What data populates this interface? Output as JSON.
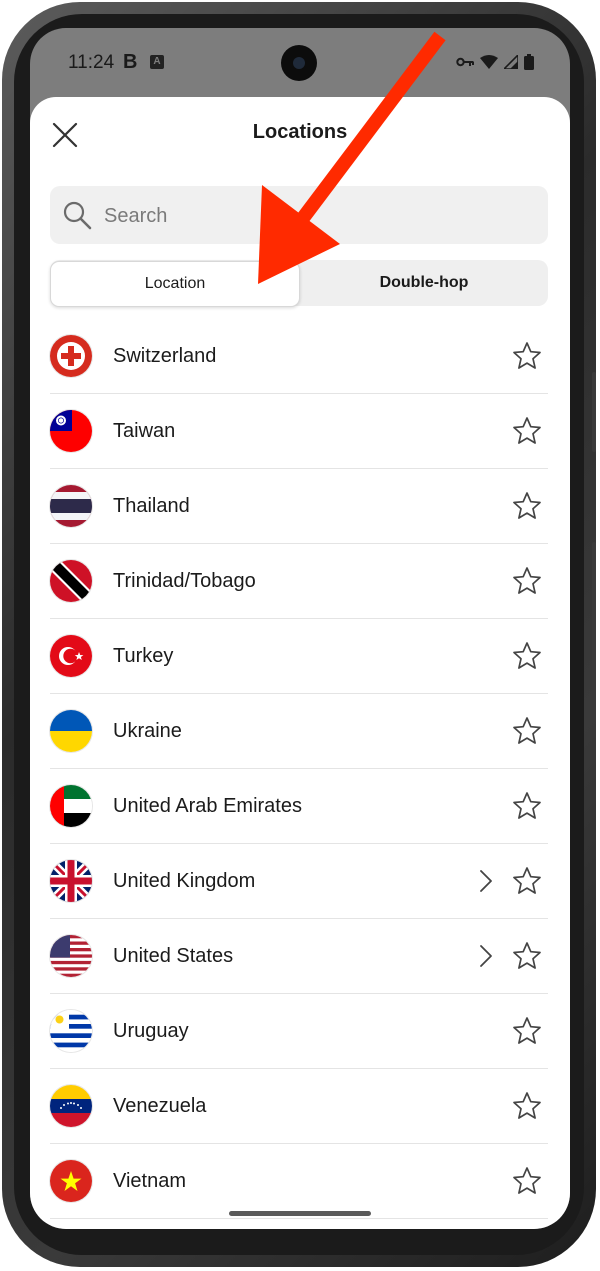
{
  "status_bar": {
    "time": "11:24",
    "b_label": "B",
    "a_label": "A"
  },
  "header": {
    "title": "Locations"
  },
  "search": {
    "placeholder": "Search"
  },
  "tabs": [
    {
      "label": "Location"
    },
    {
      "label": "Double-hop"
    }
  ],
  "countries": [
    {
      "name": "Switzerland",
      "chevron": false
    },
    {
      "name": "Taiwan",
      "chevron": false
    },
    {
      "name": "Thailand",
      "chevron": false
    },
    {
      "name": "Trinidad/Tobago",
      "chevron": false
    },
    {
      "name": "Turkey",
      "chevron": false
    },
    {
      "name": "Ukraine",
      "chevron": false
    },
    {
      "name": "United Arab Emirates",
      "chevron": false
    },
    {
      "name": "United Kingdom",
      "chevron": true
    },
    {
      "name": "United States",
      "chevron": true
    },
    {
      "name": "Uruguay",
      "chevron": false
    },
    {
      "name": "Venezuela",
      "chevron": false
    },
    {
      "name": "Vietnam",
      "chevron": false
    }
  ],
  "colors": {
    "annotation_arrow": "#ff2a00",
    "sheet": "#ffffff",
    "divider": "#e4e4e4"
  }
}
